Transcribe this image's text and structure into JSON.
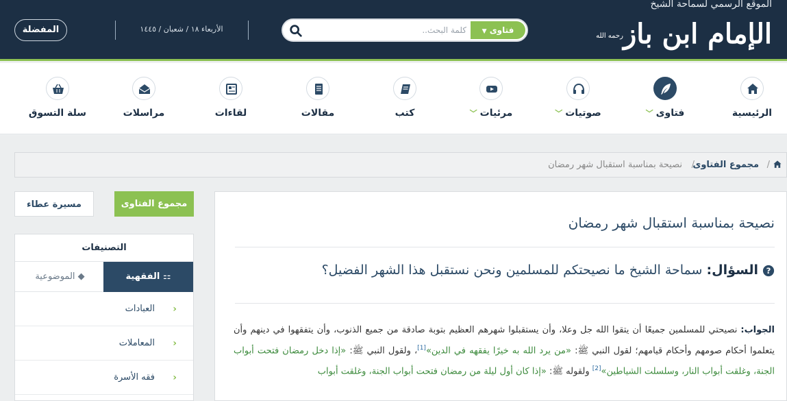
{
  "header": {
    "site_tagline": "الموقع الرسمي لسماحة الشيخ",
    "site_name": "الإمام ابن باز",
    "honorific": "رحمه الله",
    "search_type": "فتاوى",
    "search_placeholder": "كلمة البحث..",
    "date": "الأربعاء ١٨ / شعبان / ١٤٤٥",
    "favorites_label": "المفضلة"
  },
  "nav": {
    "items": [
      {
        "label": "الرئيسية",
        "icon": "home-icon",
        "dropdown": false
      },
      {
        "label": "فتاوى",
        "icon": "quill-icon",
        "dropdown": true
      },
      {
        "label": "صوتيات",
        "icon": "headphones-icon",
        "dropdown": true
      },
      {
        "label": "مرئيات",
        "icon": "video-icon",
        "dropdown": true
      },
      {
        "label": "كتب",
        "icon": "book-icon",
        "dropdown": false
      },
      {
        "label": "مقالات",
        "icon": "article-icon",
        "dropdown": false
      },
      {
        "label": "لقاءات",
        "icon": "newspaper-icon",
        "dropdown": false
      },
      {
        "label": "مراسلات",
        "icon": "mail-icon",
        "dropdown": false
      },
      {
        "label": "سلة التسوق",
        "icon": "basket-icon",
        "dropdown": false
      }
    ]
  },
  "breadcrumb": {
    "section": "مجموع الفتاوى",
    "current": "نصيحة بمناسبة استقبال شهر رمضان"
  },
  "sidebar": {
    "btn_fatawa": "مجموع الفتاوى",
    "btn_masira": "مسيرة عطاء",
    "panel_title": "التصنيفات",
    "tab_fiqh": "الفقهية",
    "tab_topic": "الموضوعية",
    "categories": [
      "العبادات",
      "المعاملات",
      "فقه الأسرة"
    ]
  },
  "article": {
    "title": "نصيحة بمناسبة استقبال شهر رمضان",
    "q_label": "السؤال:",
    "q_text": "سماحة الشيخ ما نصيحتكم للمسلمين ونحن نستقبل هذا الشهر الفضيل؟",
    "a_label": "الجواب:",
    "a_p1": "نصيحتي للمسلمين جميعًا أن يتقوا الله جل وعلا، وأن يستقبلوا شهرهم العظيم بتوبة صادقة من جميع الذنوب، وأن يتفقهوا في دينهم وأن يتعلموا أحكام صومهم وأحكام قيامهم؛ لقول النبي ﷺ:",
    "a_quote1": "«من يرد الله به خيرًا يفقهه في الدين»",
    "ref1": "[1]",
    "a_p2": "، ولقول النبي ﷺ:",
    "a_quote2": "«إذا دخل رمضان فتحت أبواب الجنة، وغلقت أبواب النار، وسلسلت الشياطين»",
    "ref2": "[2]",
    "a_p3": " ولقوله ﷺ:",
    "a_quote3": "«إذا كان أول ليلة من رمضان فتحت أبواب الجنة، وغلقت أبواب"
  },
  "colors": {
    "header_bg": "#1c2f44",
    "accent_green": "#8cc152",
    "primary_blue": "#2c4a66"
  }
}
